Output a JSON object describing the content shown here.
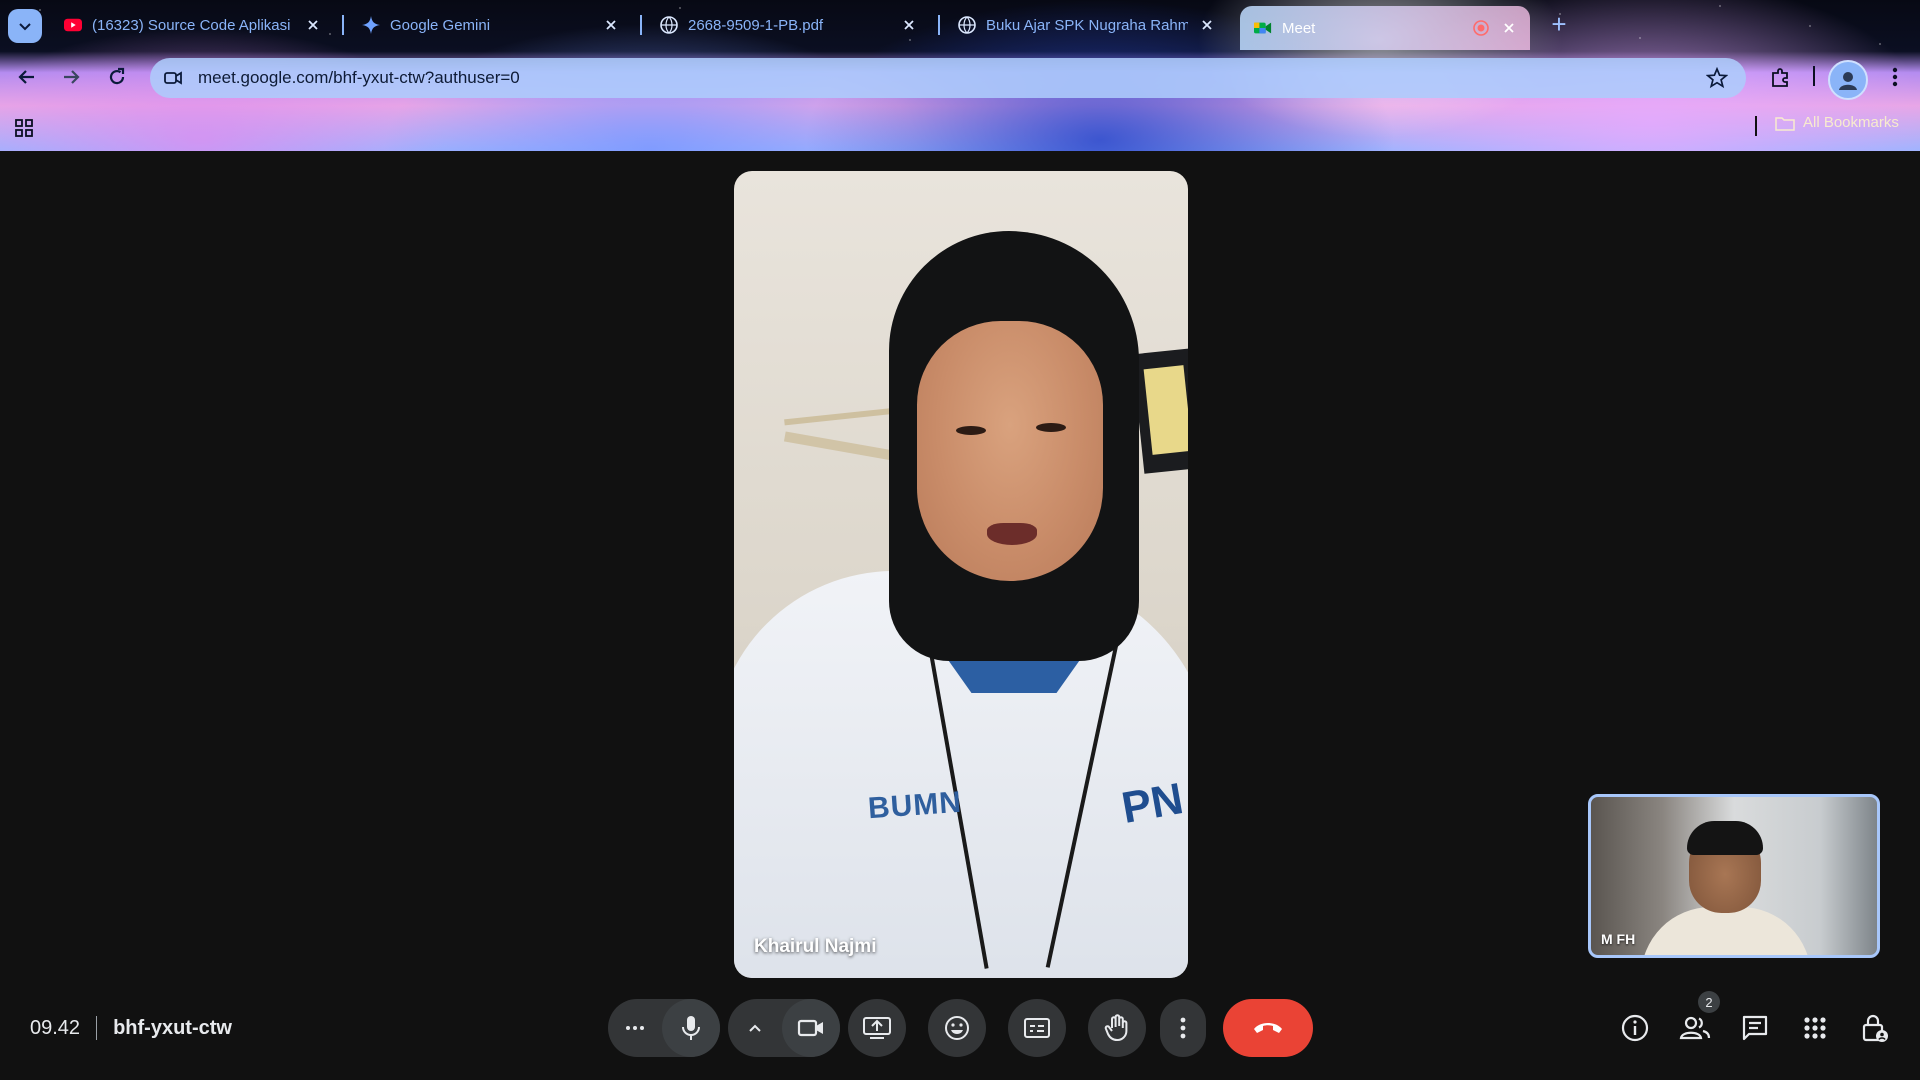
{
  "browser": {
    "tabs": [
      {
        "title": "(16323) Source Code Aplikasi SI",
        "icon": "youtube-icon"
      },
      {
        "title": "Google Gemini",
        "icon": "gemini-icon"
      },
      {
        "title": "2668-9509-1-PB.pdf",
        "icon": "globe-icon"
      },
      {
        "title": "Buku Ajar SPK Nugraha Rahmar",
        "icon": "globe-icon"
      },
      {
        "title": "Meet",
        "icon": "meet-icon",
        "active": true
      }
    ],
    "url": "meet.google.com/bhf-yxut-ctw?authuser=0",
    "bookmarks_label": "All Bookmarks"
  },
  "meeting": {
    "time": "09.42",
    "code": "bhf-yxut-ctw",
    "main_participant": "Khairul Najmi",
    "self_participant": "M FH",
    "participant_count": "2"
  },
  "colors": {
    "accent": "#8ab4f8",
    "end_call": "#ea4335",
    "stage_bg": "#111111",
    "control_bg": "#333537"
  }
}
